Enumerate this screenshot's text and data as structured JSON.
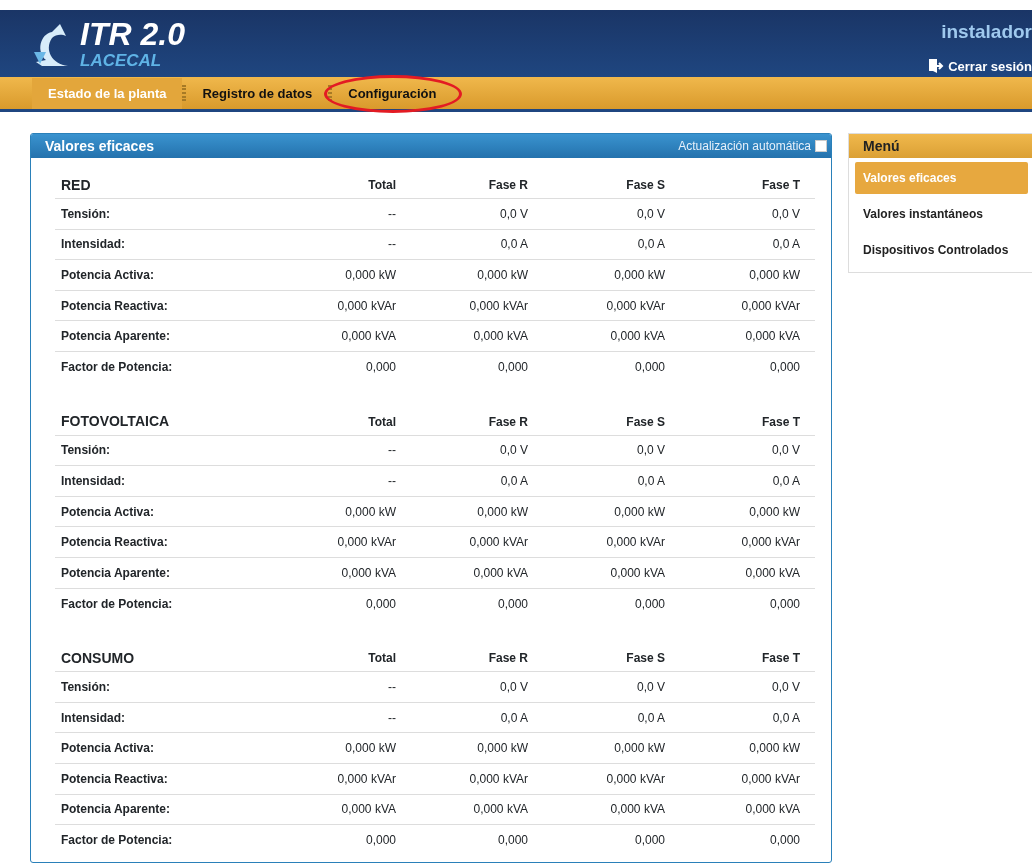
{
  "brand": {
    "title": "ITR 2.0",
    "subtitle": "LACECAL"
  },
  "user": {
    "name": "instalador",
    "logout": "Cerrar sesión"
  },
  "nav": [
    {
      "label": "Estado de la planta",
      "selected": true,
      "circled": false
    },
    {
      "label": "Registro de datos",
      "selected": false,
      "circled": false
    },
    {
      "label": "Configuración",
      "selected": false,
      "circled": true
    }
  ],
  "panel": {
    "title": "Valores eficaces",
    "auto_update": {
      "label": "Actualización automática",
      "checked": false
    },
    "sections": [
      {
        "title": "RED",
        "columns": [
          "Total",
          "Fase R",
          "Fase S",
          "Fase T"
        ],
        "rows": [
          {
            "label": "Tensión:",
            "values": [
              "--",
              "0,0 V",
              "0,0 V",
              "0,0 V"
            ]
          },
          {
            "label": "Intensidad:",
            "values": [
              "--",
              "0,0 A",
              "0,0 A",
              "0,0 A"
            ]
          },
          {
            "label": "Potencia Activa:",
            "values": [
              "0,000 kW",
              "0,000 kW",
              "0,000 kW",
              "0,000 kW"
            ]
          },
          {
            "label": "Potencia Reactiva:",
            "values": [
              "0,000 kVAr",
              "0,000 kVAr",
              "0,000 kVAr",
              "0,000 kVAr"
            ]
          },
          {
            "label": "Potencia Aparente:",
            "values": [
              "0,000 kVA",
              "0,000 kVA",
              "0,000 kVA",
              "0,000 kVA"
            ]
          },
          {
            "label": "Factor de Potencia:",
            "values": [
              "0,000",
              "0,000",
              "0,000",
              "0,000"
            ]
          }
        ]
      },
      {
        "title": "FOTOVOLTAICA",
        "columns": [
          "Total",
          "Fase R",
          "Fase S",
          "Fase T"
        ],
        "rows": [
          {
            "label": "Tensión:",
            "values": [
              "--",
              "0,0 V",
              "0,0 V",
              "0,0 V"
            ]
          },
          {
            "label": "Intensidad:",
            "values": [
              "--",
              "0,0 A",
              "0,0 A",
              "0,0 A"
            ]
          },
          {
            "label": "Potencia Activa:",
            "values": [
              "0,000 kW",
              "0,000 kW",
              "0,000 kW",
              "0,000 kW"
            ]
          },
          {
            "label": "Potencia Reactiva:",
            "values": [
              "0,000 kVAr",
              "0,000 kVAr",
              "0,000 kVAr",
              "0,000 kVAr"
            ]
          },
          {
            "label": "Potencia Aparente:",
            "values": [
              "0,000 kVA",
              "0,000 kVA",
              "0,000 kVA",
              "0,000 kVA"
            ]
          },
          {
            "label": "Factor de Potencia:",
            "values": [
              "0,000",
              "0,000",
              "0,000",
              "0,000"
            ]
          }
        ]
      },
      {
        "title": "CONSUMO",
        "columns": [
          "Total",
          "Fase R",
          "Fase S",
          "Fase T"
        ],
        "rows": [
          {
            "label": "Tensión:",
            "values": [
              "--",
              "0,0 V",
              "0,0 V",
              "0,0 V"
            ]
          },
          {
            "label": "Intensidad:",
            "values": [
              "--",
              "0,0 A",
              "0,0 A",
              "0,0 A"
            ]
          },
          {
            "label": "Potencia Activa:",
            "values": [
              "0,000 kW",
              "0,000 kW",
              "0,000 kW",
              "0,000 kW"
            ]
          },
          {
            "label": "Potencia Reactiva:",
            "values": [
              "0,000 kVAr",
              "0,000 kVAr",
              "0,000 kVAr",
              "0,000 kVAr"
            ]
          },
          {
            "label": "Potencia Aparente:",
            "values": [
              "0,000 kVA",
              "0,000 kVA",
              "0,000 kVA",
              "0,000 kVA"
            ]
          },
          {
            "label": "Factor de Potencia:",
            "values": [
              "0,000",
              "0,000",
              "0,000",
              "0,000"
            ]
          }
        ]
      }
    ]
  },
  "menu": {
    "title": "Menú",
    "items": [
      {
        "label": "Valores eficaces",
        "selected": true
      },
      {
        "label": "Valores instantáneos",
        "selected": false
      },
      {
        "label": "Dispositivos Controlados",
        "selected": false
      }
    ]
  }
}
